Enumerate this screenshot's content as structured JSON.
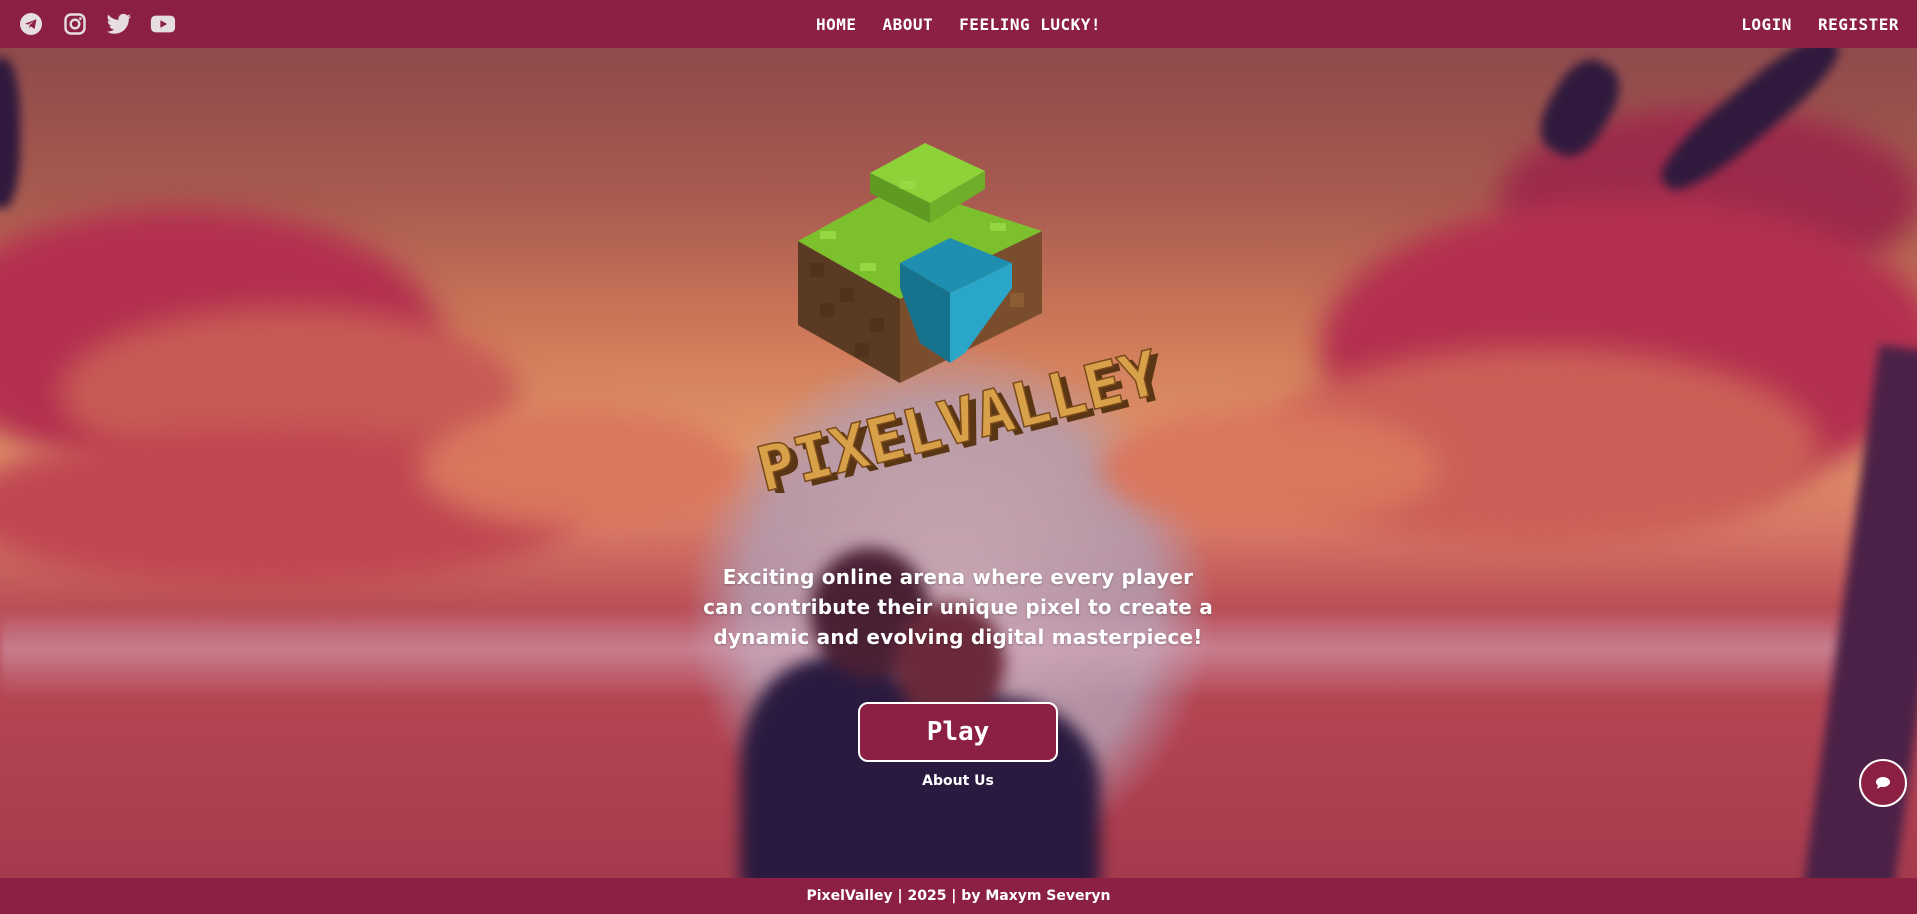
{
  "header": {
    "socials": [
      {
        "icon": "telegram-icon"
      },
      {
        "icon": "instagram-icon"
      },
      {
        "icon": "twitter-icon"
      },
      {
        "icon": "youtube-icon"
      }
    ],
    "nav": {
      "home": "HOME",
      "about": "ABOUT",
      "lucky": "FEELING LUCKY!"
    },
    "auth": {
      "login": "LOGIN",
      "register": "REGISTER"
    }
  },
  "hero": {
    "logo_text": "PIXELVALLEY",
    "tagline": "Exciting online arena where every player can contribute their unique pixel to create a dynamic and evolving digital masterpiece!",
    "play_label": "Play",
    "about_label": "About Us",
    "chat_icon": "chat-icon"
  },
  "footer": {
    "text": "PixelValley | 2025 | by Maxym Severyn"
  },
  "colors": {
    "brand": "#8b2042",
    "text": "#ffffff",
    "logo_gold": "#d9a04a",
    "grass": "#7cc02e",
    "water": "#1e8fb0",
    "dirt": "#6b4426"
  }
}
